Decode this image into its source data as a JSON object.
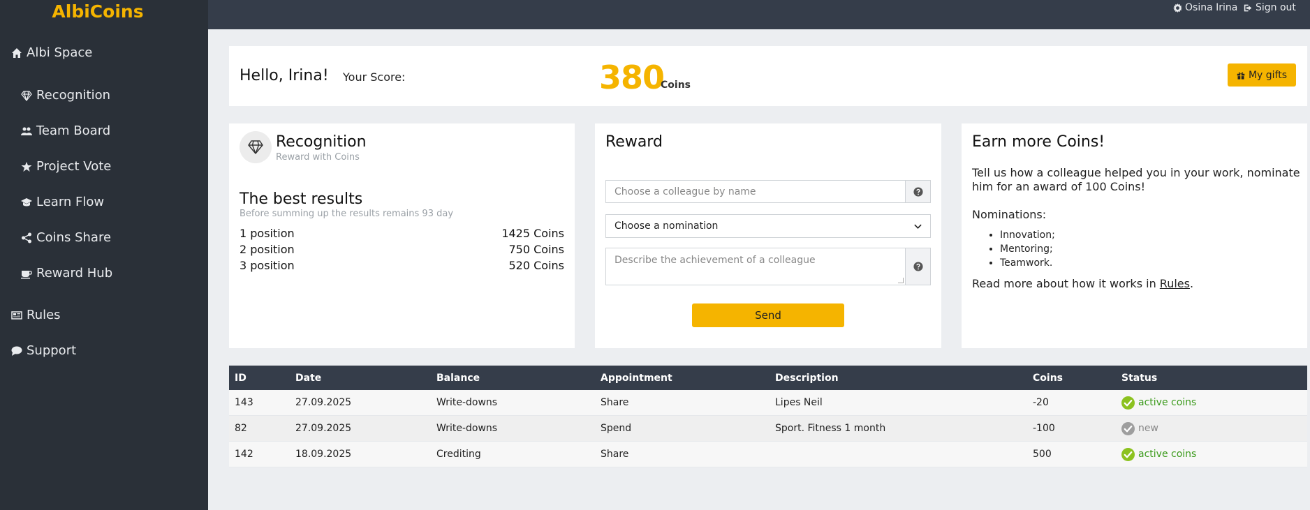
{
  "app": {
    "brand": "AlbiCoins"
  },
  "sidebar": {
    "items": [
      {
        "label": "Albi Space",
        "icon": "home-icon"
      },
      {
        "label": "Recognition",
        "icon": "diamond-icon"
      },
      {
        "label": "Team Board",
        "icon": "users-icon"
      },
      {
        "label": "Project Vote",
        "icon": "star-icon"
      },
      {
        "label": "Learn Flow",
        "icon": "graduation-cap-icon"
      },
      {
        "label": "Coins Share",
        "icon": "share-icon"
      },
      {
        "label": "Reward Hub",
        "icon": "coffee-icon"
      },
      {
        "label": "Rules",
        "icon": "newspaper-icon"
      },
      {
        "label": "Support",
        "icon": "chat-icon"
      }
    ]
  },
  "topbar": {
    "user_name": "Osina Irina",
    "sign_out": "Sign out"
  },
  "score": {
    "greeting": "Hello, Irina!",
    "label": "Your Score:",
    "value": "380",
    "unit": "Coins",
    "gifts_button": "My gifts"
  },
  "recognition": {
    "title": "Recognition",
    "subtitle": "Reward with Coins",
    "best_title": "The best results",
    "best_subtitle": "Before summing up the results remains 93 day",
    "positions": [
      {
        "label": "1 position",
        "value": "1425 Coins"
      },
      {
        "label": "2 position",
        "value": "750 Coins"
      },
      {
        "label": "3 position",
        "value": "520 Coins"
      }
    ]
  },
  "reward": {
    "title": "Reward",
    "colleague_placeholder": "Choose a colleague by name",
    "nomination_selected": "Choose a nomination",
    "description_placeholder": "Describe the achievement of a colleague",
    "send_button": "Send"
  },
  "earn": {
    "title": "Earn more Coins!",
    "text": "Tell us how a colleague helped you in your work, nominate him for an award of 100 Coins!",
    "nominations_label": "Nominations:",
    "nominations": [
      "Innovation;",
      "Mentoring;",
      "Teamwork."
    ],
    "read_more_prefix": "Read more about how it works in ",
    "rules_link": "Rules",
    "read_more_suffix": "."
  },
  "table": {
    "headers": [
      "ID",
      "Date",
      "Balance",
      "Appointment",
      "Description",
      "Coins",
      "Status"
    ],
    "rows": [
      {
        "id": "143",
        "date": "27.09.2025",
        "balance": "Write-downs",
        "appointment": "Share",
        "description": "Lipes Neil",
        "coins": "-20",
        "status": "active coins",
        "status_type": "active"
      },
      {
        "id": "82",
        "date": "27.09.2025",
        "balance": "Write-downs",
        "appointment": "Spend",
        "description": "Sport. Fitness 1 month",
        "coins": "-100",
        "status": "new",
        "status_type": "new"
      },
      {
        "id": "142",
        "date": "18.09.2025",
        "balance": "Crediting",
        "appointment": "Share",
        "description": "",
        "coins": "500",
        "status": "active coins",
        "status_type": "active"
      }
    ]
  },
  "colors": {
    "accent": "#f5b400",
    "sidebar_bg": "#2a3038",
    "topbar_bg": "#353d4a",
    "status_active": "#8cc21f",
    "status_new": "#9e9e9e"
  }
}
